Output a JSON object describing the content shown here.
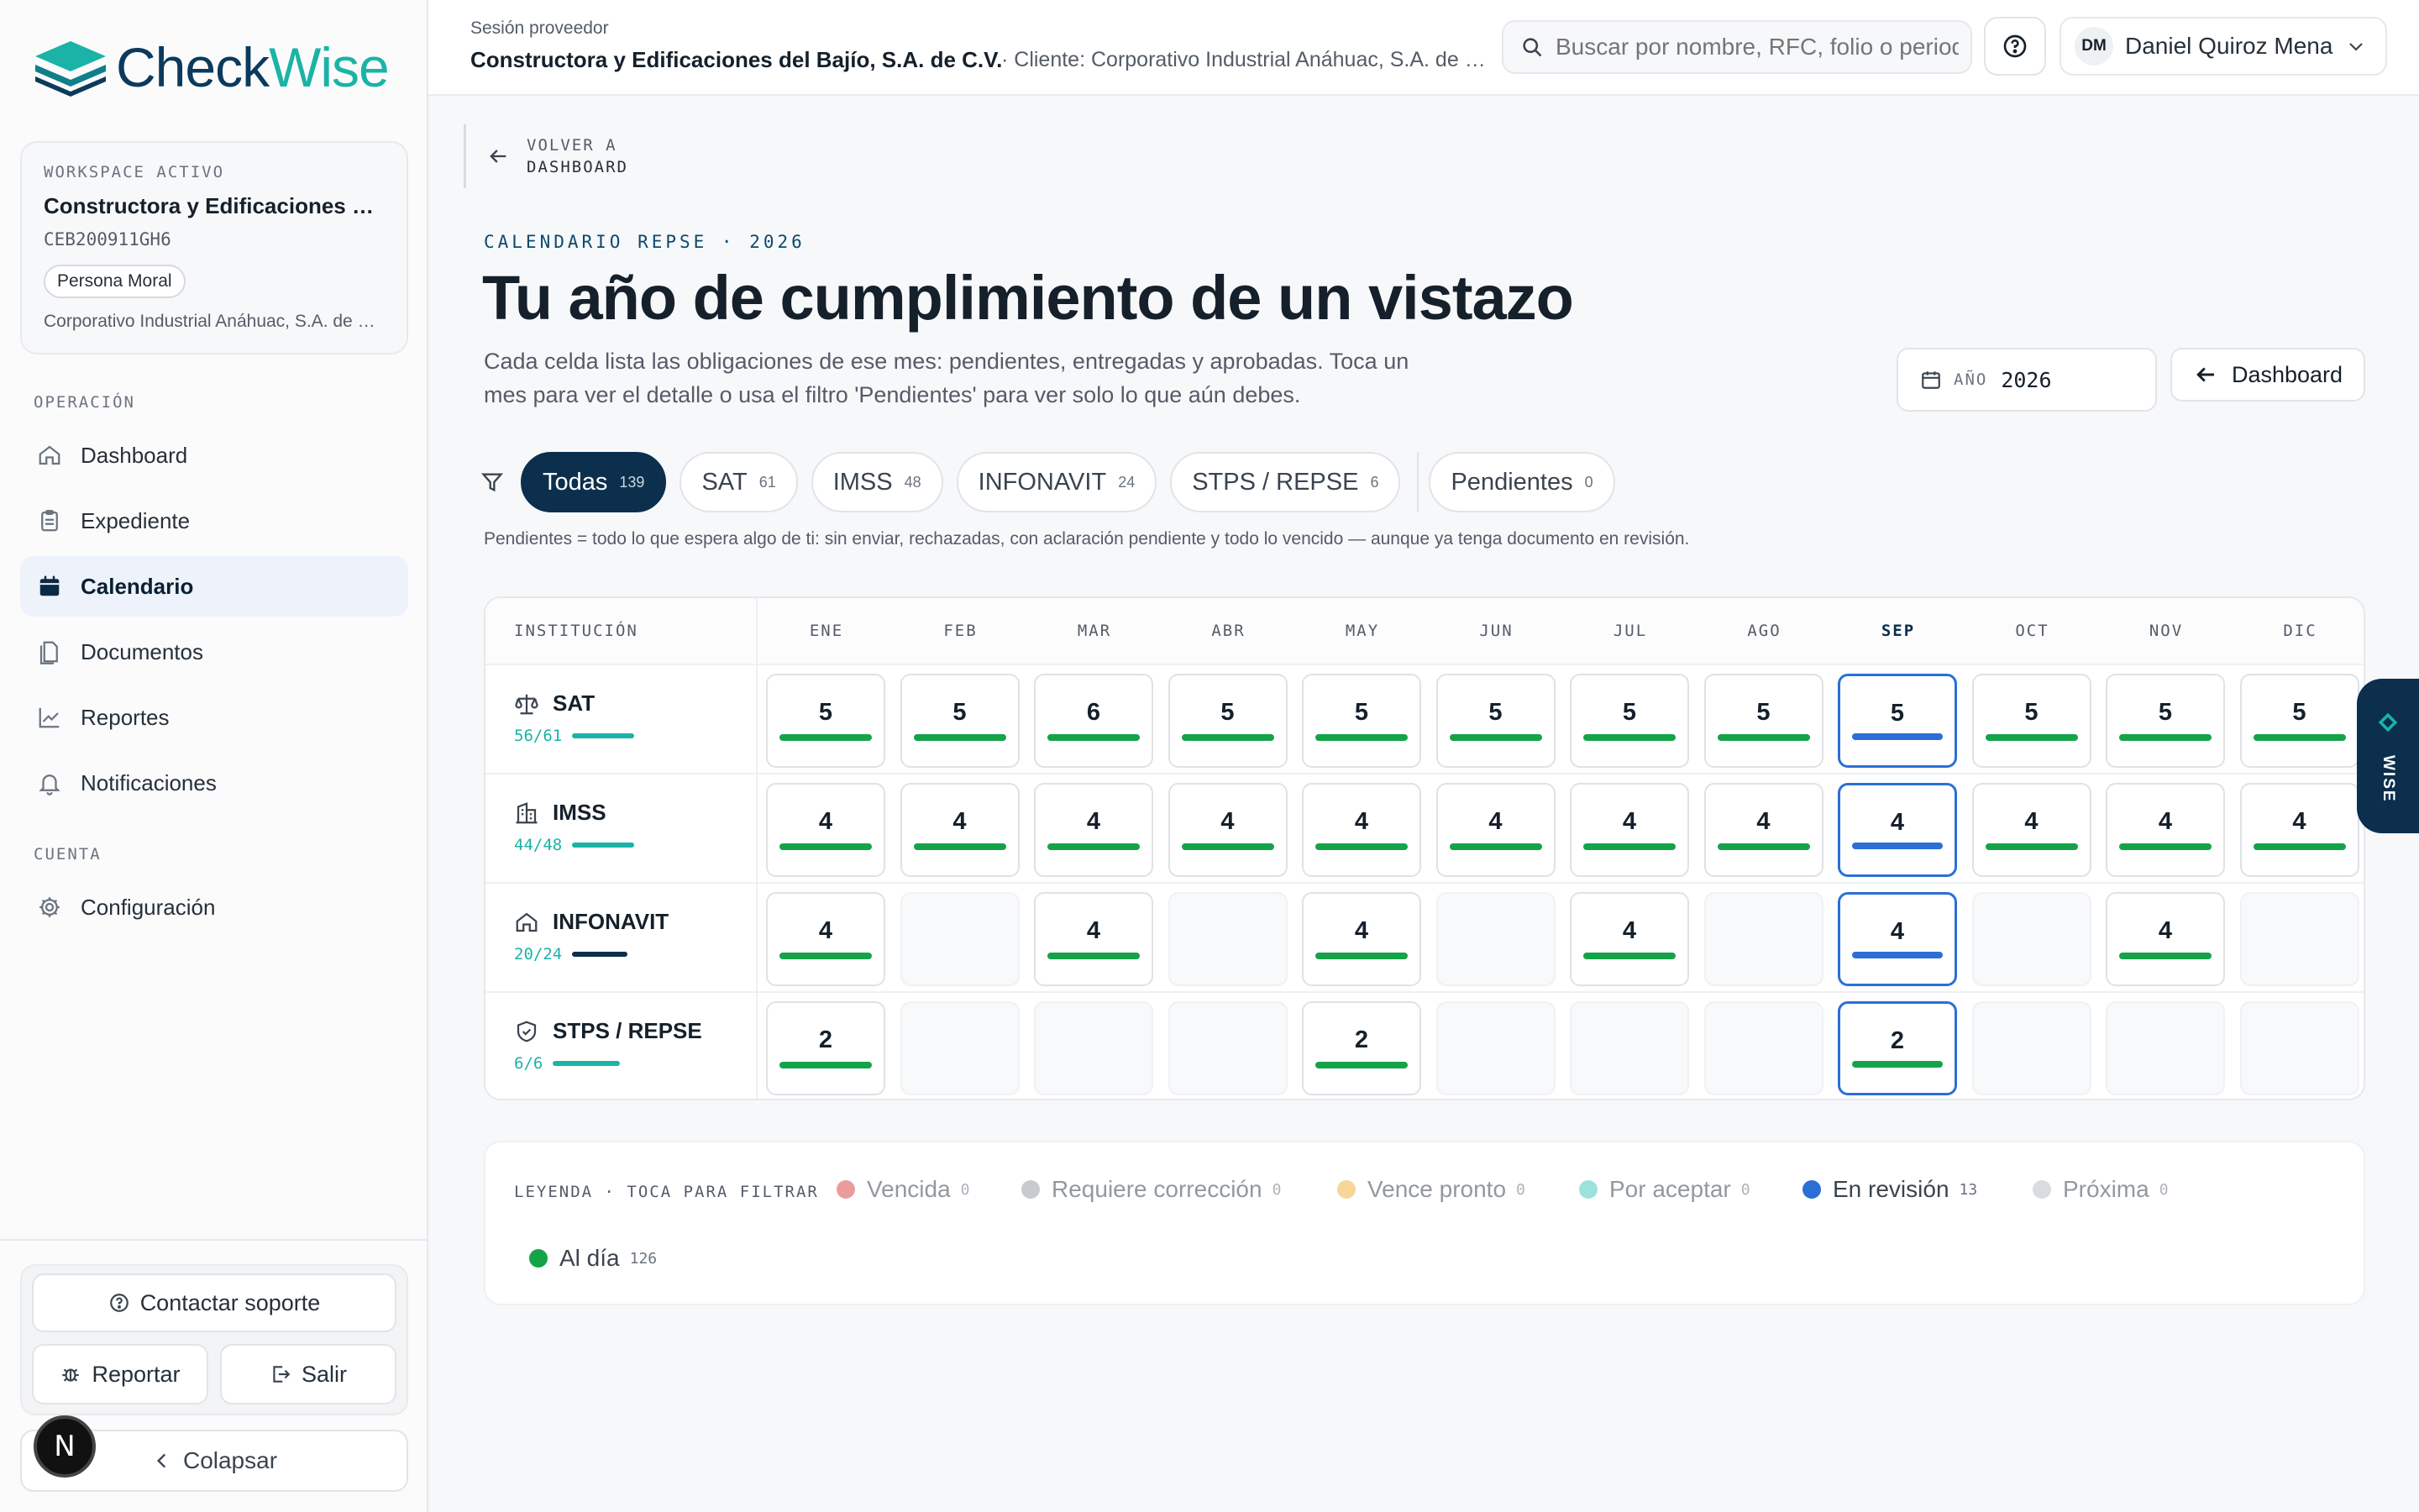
{
  "brand": {
    "name_a": "Check",
    "name_b": "Wise"
  },
  "workspace": {
    "label": "WORKSPACE ACTIVO",
    "name": "Constructora y Edificaciones del Bajío, S.A. de C.V.",
    "rfc": "CEB200911GH6",
    "type": "Persona Moral",
    "client": "Corporativo Industrial Anáhuac, S.A. de C.V."
  },
  "nav": {
    "section_op": "OPERACIÓN",
    "section_account": "CUENTA",
    "items": [
      "Dashboard",
      "Expediente",
      "Calendario",
      "Documentos",
      "Reportes",
      "Notificaciones"
    ],
    "config": "Configuración"
  },
  "footer": {
    "support": "Contactar soporte",
    "report": "Reportar",
    "logout": "Salir",
    "collapse": "Colapsar",
    "badge": "N"
  },
  "topbar": {
    "session_label": "Sesión proveedor",
    "session_name": "Constructora y Edificaciones del Bajío, S.A. de C.V.",
    "session_client": "· Cliente: Corporativo Industrial Anáhuac, S.A. de C.V.",
    "search_placeholder": "Buscar por nombre, RFC, folio o periodo",
    "user_initials": "DM",
    "user_name": "Daniel Quiroz Mena"
  },
  "back": {
    "line1": "VOLVER A",
    "line2": "DASHBOARD"
  },
  "page": {
    "kicker": "CALENDARIO REPSE · 2026",
    "title": "Tu año de cumplimiento de un vistazo",
    "description": "Cada celda lista las obligaciones de ese mes: pendientes, entregadas y aprobadas. Toca un mes para ver el detalle o usa el filtro 'Pendientes' para ver solo lo que aún debes.",
    "year_label": "AÑO",
    "year_value": "2026",
    "dashboard_button": "Dashboard"
  },
  "filters": [
    {
      "label": "Todas",
      "count": "139"
    },
    {
      "label": "SAT",
      "count": "61"
    },
    {
      "label": "IMSS",
      "count": "48"
    },
    {
      "label": "INFONAVIT",
      "count": "24"
    },
    {
      "label": "STPS / REPSE",
      "count": "6"
    },
    {
      "label": "Pendientes",
      "count": "0"
    }
  ],
  "filter_note": "Pendientes = todo lo que espera algo de ti: sin enviar, rechazadas, con aclaración pendiente y todo lo vencido — aunque ya tenga documento en revisión.",
  "grid": {
    "inst_header": "INSTITUCIÓN",
    "months": [
      "ENE",
      "FEB",
      "MAR",
      "ABR",
      "MAY",
      "JUN",
      "JUL",
      "AGO",
      "SEP",
      "OCT",
      "NOV",
      "DIC"
    ],
    "current_month_index": 8,
    "rows": [
      {
        "name": "SAT",
        "progress_text": "56/61",
        "progress": 0.92,
        "cells": [
          "5",
          "5",
          "6",
          "5",
          "5",
          "5",
          "5",
          "5",
          "5",
          "5",
          "5",
          "5"
        ]
      },
      {
        "name": "IMSS",
        "progress_text": "44/48",
        "progress": 0.92,
        "cells": [
          "4",
          "4",
          "4",
          "4",
          "4",
          "4",
          "4",
          "4",
          "4",
          "4",
          "4",
          "4"
        ]
      },
      {
        "name": "INFONAVIT",
        "progress_text": "20/24",
        "progress": 0.83,
        "cells": [
          "4",
          "",
          "4",
          "",
          "4",
          "",
          "4",
          "",
          "4",
          "",
          "4",
          ""
        ]
      },
      {
        "name": "STPS / REPSE",
        "progress_text": "6/6",
        "progress": 1.0,
        "cells": [
          "2",
          "",
          "",
          "",
          "2",
          "",
          "",
          "",
          "2",
          "",
          "",
          ""
        ]
      }
    ],
    "review_cells": [
      [
        0,
        8
      ],
      [
        1,
        8
      ],
      [
        2,
        8
      ]
    ]
  },
  "wise_tab": "WISE",
  "legend": {
    "title": "LEYENDA · TOCA PARA FILTRAR",
    "items": [
      {
        "label": "Vencida",
        "count": "0",
        "color": "#d94b4b"
      },
      {
        "label": "Requiere corrección",
        "count": "0",
        "color": "#9aa0a8"
      },
      {
        "label": "Vence pronto",
        "count": "0",
        "color": "#f2b544"
      },
      {
        "label": "Por aceptar",
        "count": "0",
        "color": "#4cc9c0"
      },
      {
        "label": "En revisión",
        "count": "13",
        "color": "#2b6fd6"
      },
      {
        "label": "Próxima",
        "count": "0",
        "color": "#b9bec5"
      },
      {
        "label": "Al día",
        "count": "126",
        "color": "#15a34a"
      }
    ]
  },
  "colors": {
    "accent": "#1bb3a7",
    "navy": "#0b2f4d",
    "ok": "#15a34a",
    "review": "#2b6fd6"
  }
}
